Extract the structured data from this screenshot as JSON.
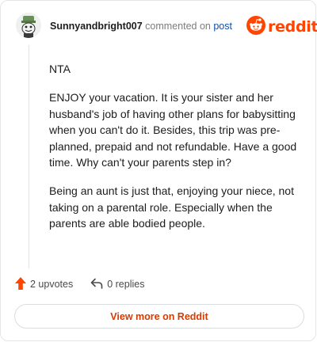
{
  "header": {
    "username": "Sunnyandbright007",
    "commented_text": "commented on",
    "post_link": "post",
    "brand": "reddit"
  },
  "comment": {
    "paragraphs": [
      "NTA",
      "ENJOY your vacation. It is your sister and her husband's job of having other plans for babysitting when you can't do it. Besides, this trip was pre-planned, prepaid and not refundable. Have a good time. Why can't your parents step in?",
      "Being an aunt is just that, enjoying your niece, not taking on a parental role. Especially when the parents are able bodied people."
    ]
  },
  "footer": {
    "upvotes": "2 upvotes",
    "replies": "0 replies",
    "view_more": "View more on Reddit"
  },
  "colors": {
    "brand": "#ff4500",
    "upvote": "#ff4500",
    "link": "#0f4fa6",
    "view_more": "#d93a00"
  },
  "icons": {
    "upvote": "arrow-up-icon",
    "reply": "reply-arrow-icon",
    "logo": "reddit-snoo-icon"
  }
}
